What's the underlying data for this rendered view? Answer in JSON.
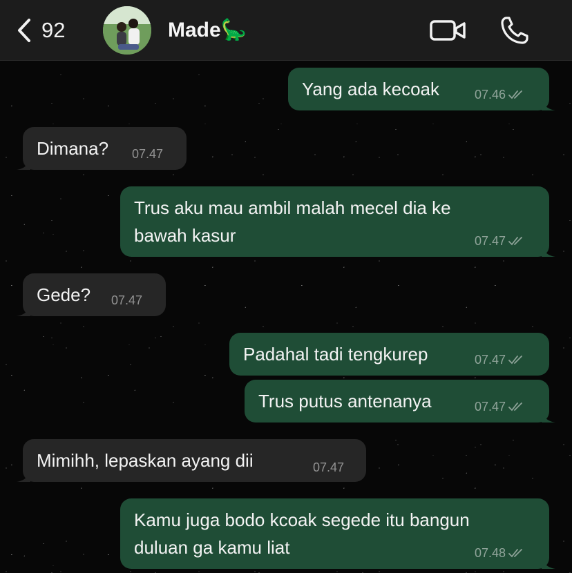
{
  "header": {
    "back_count": "92",
    "contact_name": "Made🦕"
  },
  "messages": [
    {
      "direction": "outgoing",
      "text": "Yang ada kecoak",
      "time": "07.46",
      "status": "read"
    },
    {
      "direction": "incoming",
      "text": "Dimana?",
      "time": "07.47"
    },
    {
      "direction": "outgoing",
      "lines": [
        "Trus aku mau ambil malah mecel dia ke",
        "bawah kasur"
      ],
      "time": "07.47",
      "status": "read"
    },
    {
      "direction": "incoming",
      "text": "Gede?",
      "time": "07.47"
    },
    {
      "direction": "outgoing",
      "text": "Padahal tadi tengkurep",
      "time": "07.47",
      "status": "read"
    },
    {
      "direction": "outgoing",
      "text": "Trus putus antenanya",
      "time": "07.47",
      "status": "read"
    },
    {
      "direction": "incoming",
      "text": "Mimihh, lepaskan ayang dii",
      "time": "07.47"
    },
    {
      "direction": "outgoing",
      "lines": [
        "Kamu juga bodo kcoak segede itu bangun",
        "duluan ga kamu liat"
      ],
      "time": "07.48",
      "status": "read"
    }
  ],
  "colors": {
    "outgoing_bubble": "#1f4d36",
    "incoming_bubble": "#262626",
    "header_bg": "#1c1c1c"
  },
  "icons": [
    "chevron-left-icon",
    "video-camera-icon",
    "phone-icon",
    "double-check-icon"
  ]
}
